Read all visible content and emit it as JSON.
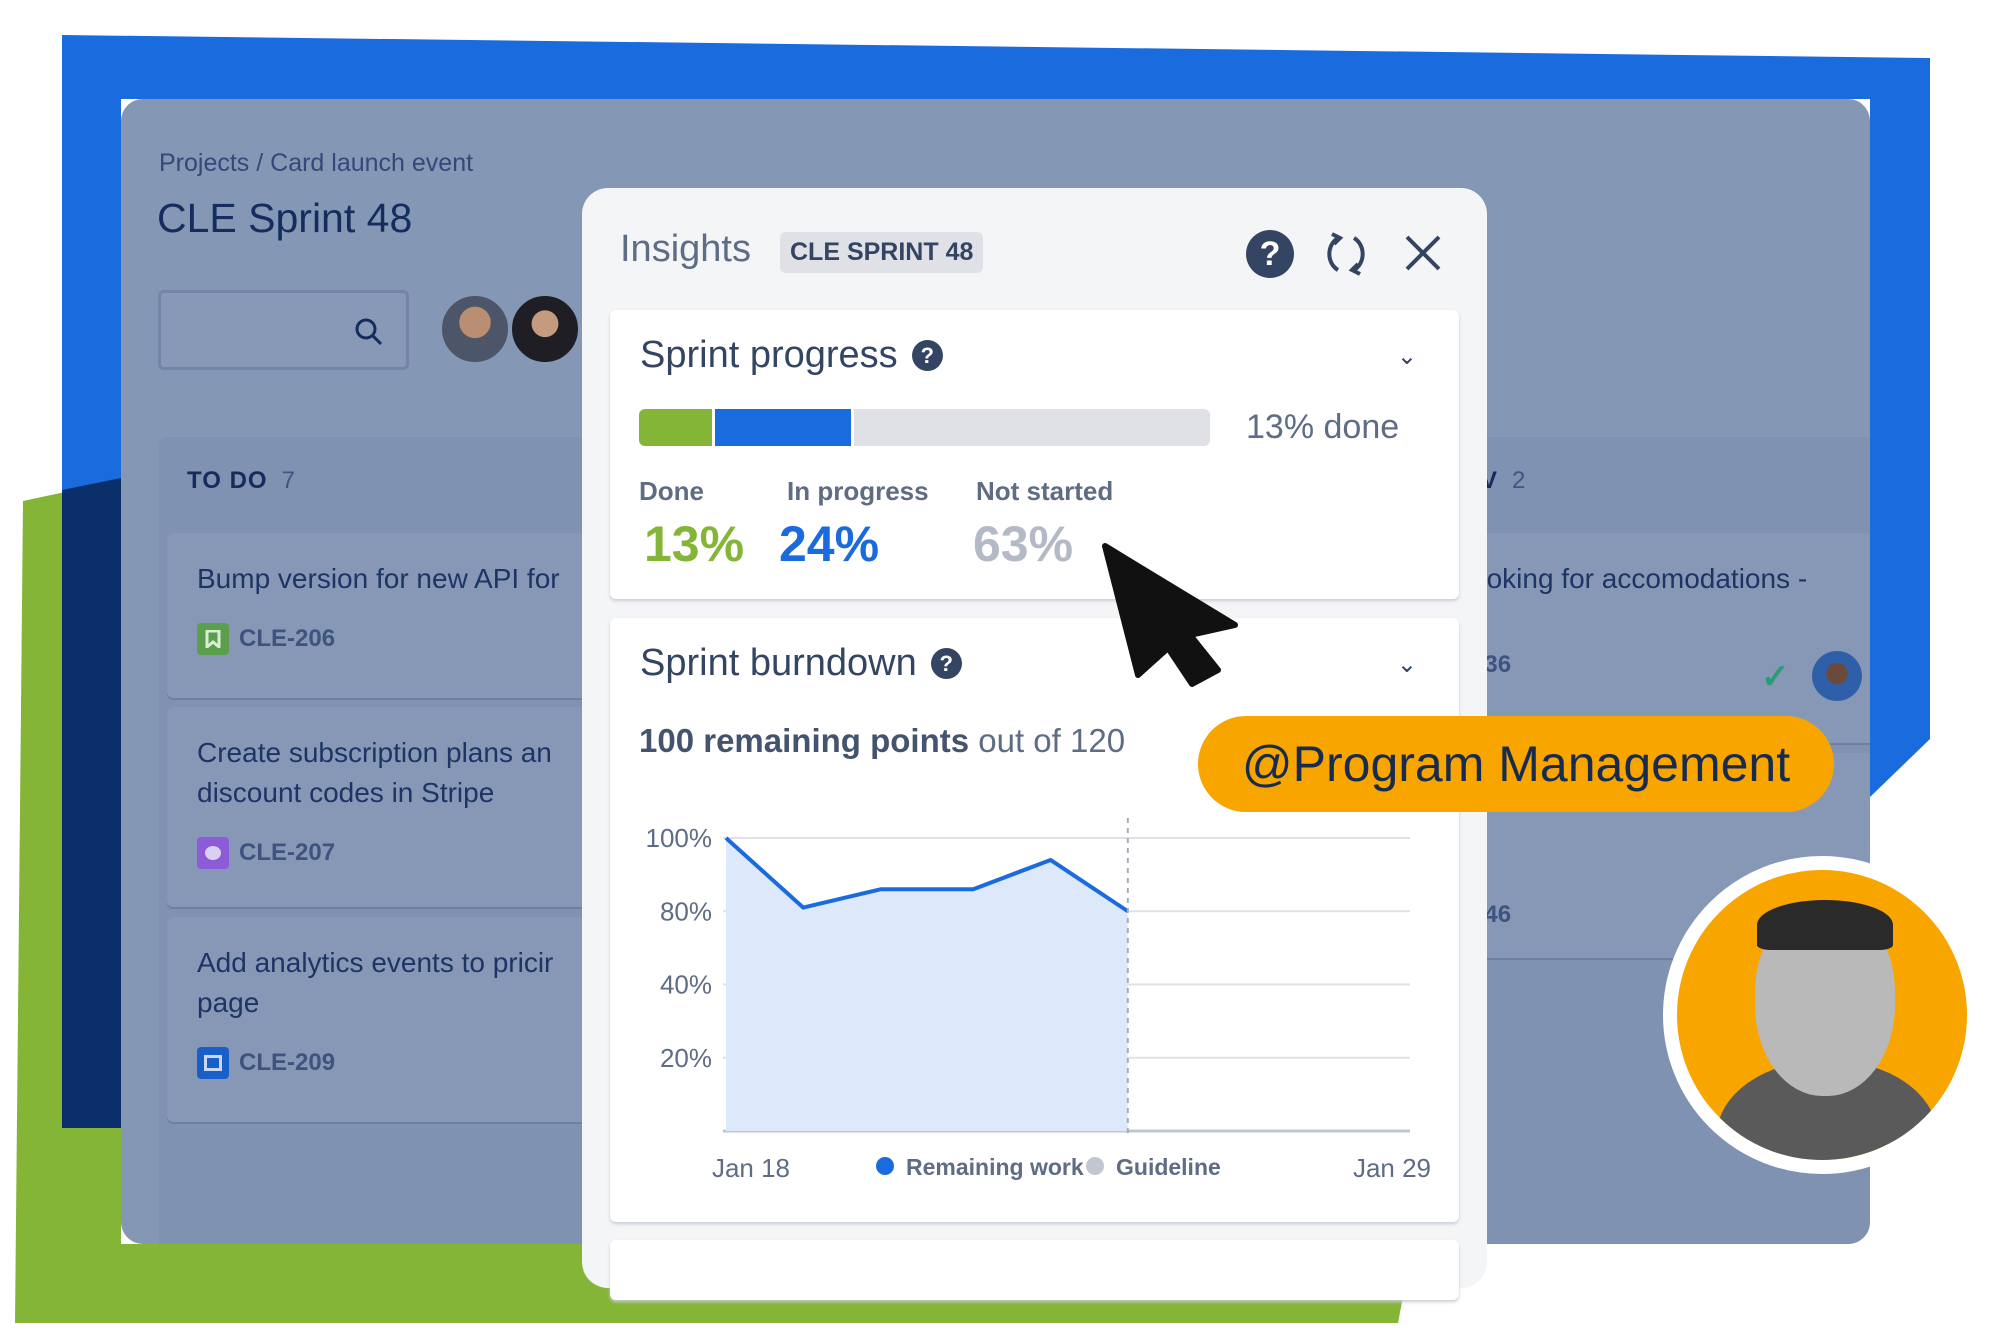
{
  "colors": {
    "brand_blue": "#1a6bde",
    "green": "#84b536",
    "navy": "#0a2f6a",
    "accent_orange": "#f8a500",
    "done": "#84b536",
    "in_progress": "#1a6bde",
    "not_started": "#c1c7d0"
  },
  "board": {
    "breadcrumb": "Projects / Card launch event",
    "title": "CLE Sprint 48",
    "search": {
      "placeholder": "",
      "icon": "search-icon"
    },
    "columns": [
      {
        "title": "TO DO",
        "count": "7",
        "cards": [
          {
            "title": "Bump version for new API for",
            "key": "CLE-206",
            "type": "story",
            "icon_color": "#5b9e4d"
          },
          {
            "title": "Create subscription plans an",
            "title_line2": "discount codes in Stripe",
            "key": "CLE-207",
            "type": "epic",
            "icon_color": "#8e5bd8"
          },
          {
            "title": "Add analytics events to pricir",
            "title_line2": "page",
            "key": "CLE-209",
            "type": "task",
            "icon_color": "#1a5fc8"
          }
        ]
      },
      {
        "title": "V",
        "count": "2",
        "cards": [
          {
            "title": "ooking for accomodations -",
            "key": "336",
            "status": "check-icon"
          },
          {
            "key": "346"
          }
        ]
      }
    ]
  },
  "insights": {
    "title": "Insights",
    "badge": "CLE SPRINT 48",
    "progress": {
      "title": "Sprint progress",
      "done_text": "13% done",
      "segments": [
        {
          "label": "Done",
          "value": "13%",
          "pct": 13
        },
        {
          "label": "In progress",
          "value": "24%",
          "pct": 24
        },
        {
          "label": "Not started",
          "value": "63%",
          "pct": 63
        }
      ]
    },
    "burndown": {
      "title": "Sprint burndown",
      "remaining_bold": "100 remaining points",
      "remaining_rest": " out of 120"
    }
  },
  "chart_data": {
    "type": "area",
    "y_ticks": [
      "100%",
      "80%",
      "40%",
      "20%"
    ],
    "x_ticks": [
      "Jan 18",
      "Jan 29"
    ],
    "x_range_day_of_jan": [
      18,
      29
    ],
    "series": [
      {
        "name": "Remaining work",
        "color": "#1a6bde",
        "x_day_of_jan": [
          18,
          19.25,
          20.5,
          22,
          23.25,
          24.5
        ],
        "values": [
          100,
          81,
          86,
          86,
          94,
          80
        ]
      }
    ],
    "legend": [
      {
        "name": "Remaining work",
        "color": "#1a6bde"
      },
      {
        "name": "Guideline",
        "color": "#c1c7d0"
      }
    ],
    "today_marker_day_of_jan": 24.5,
    "grid": true,
    "legend_placement": "bottom"
  },
  "mention": "@Program Management"
}
